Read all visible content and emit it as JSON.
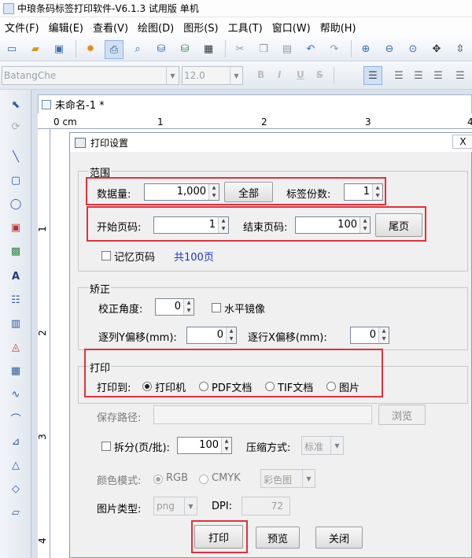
{
  "window": {
    "title": "中琅条码标签打印软件-V6.1.3 试用版 单机"
  },
  "menu": [
    "文件(F)",
    "编辑(E)",
    "查看(V)",
    "绘图(D)",
    "图形(S)",
    "工具(T)",
    "窗口(W)",
    "帮助(H)"
  ],
  "font_toolbar": {
    "font_name": "BatangChe",
    "font_size": "12.0",
    "bold": "B",
    "italic": "I",
    "underline": "U",
    "strike": "S"
  },
  "doc": {
    "tab": "未命名-1 *",
    "ruler_top": [
      "0 cm",
      "1",
      "2",
      "3",
      "4"
    ],
    "ruler_left": [
      "1",
      "2",
      "3",
      "4"
    ]
  },
  "dialog": {
    "title": "打印设置",
    "close": "X",
    "range": {
      "label": "范围",
      "data_count_label": "数据量:",
      "data_count": "1,000",
      "all_button": "全部",
      "copies_label": "标签份数:",
      "copies": "1",
      "start_page_label": "开始页码:",
      "start_page": "1",
      "end_page_label": "结束页码:",
      "end_page": "100",
      "last_page_button": "尾页",
      "remember_label": "记忆页码",
      "total_pages": "共100页"
    },
    "correction": {
      "label": "矫正",
      "angle_label": "校正角度:",
      "angle": "0",
      "mirror_label": "水平镜像",
      "y_offset_label": "逐列Y偏移(mm):",
      "y_offset": "0",
      "x_offset_label": "逐行X偏移(mm):",
      "x_offset": "0"
    },
    "print": {
      "label": "打印",
      "to_label": "打印到:",
      "options": [
        "打印机",
        "PDF文档",
        "TIF文档",
        "图片"
      ],
      "selected": "打印机"
    },
    "save_path_label": "保存路径:",
    "browse": "浏览",
    "split_label": "拆分(页/批):",
    "split": "100",
    "compress_label": "压缩方式:",
    "compress": "标准",
    "color_mode_label": "颜色模式:",
    "color_rgb": "RGB",
    "color_cmyk": "CMYK",
    "color_select": "彩色图",
    "image_type_label": "图片类型:",
    "image_type": "png",
    "dpi_label": "DPI:",
    "dpi": "72",
    "buttons": {
      "print": "打印",
      "preview": "预览",
      "close": "关闭"
    }
  },
  "colors": {
    "highlight": "#e2303b",
    "accent_link": "#1a33d6"
  }
}
